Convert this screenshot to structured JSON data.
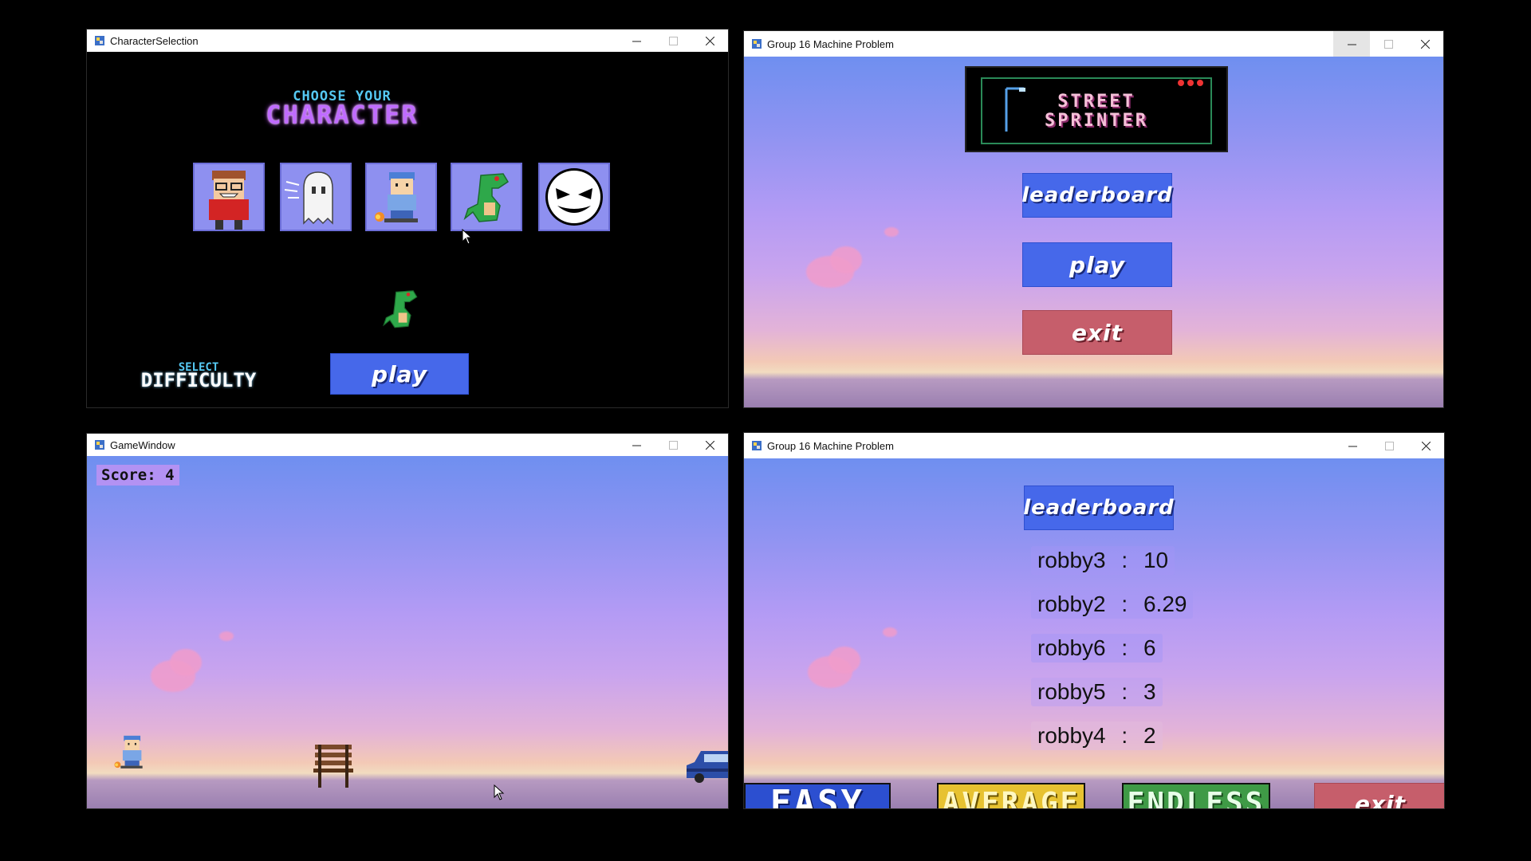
{
  "windows": {
    "char_select": {
      "title": "CharacterSelection"
    },
    "menu": {
      "title": "Group 16 Machine Problem"
    },
    "game": {
      "title": "GameWindow"
    },
    "leaderboard": {
      "title": "Group 16 Machine Problem"
    }
  },
  "char_select": {
    "heading_line1": "CHOOSE YOUR",
    "heading_line2": "CHARACTER",
    "characters": [
      "red-hoodie-boy",
      "ghost",
      "skater-kid",
      "green-dinosaur",
      "moon-face"
    ],
    "selected_character": "green-dinosaur",
    "difficulty_line1": "SELECT",
    "difficulty_line2": "DIFFICULTY",
    "play_label": "play"
  },
  "menu": {
    "logo_line1": "STREET",
    "logo_line2": "SPRINTER",
    "leaderboard_label": "leaderboard",
    "play_label": "play",
    "exit_label": "exit"
  },
  "game": {
    "score_text": "Score: 4"
  },
  "leaderboard": {
    "header_label": "leaderboard",
    "rows": [
      {
        "name": "robby3",
        "sep": ":",
        "score": "10"
      },
      {
        "name": "robby2",
        "sep": ":",
        "score": "6.29"
      },
      {
        "name": "robby6",
        "sep": ":",
        "score": "6"
      },
      {
        "name": "robby5",
        "sep": ":",
        "score": "3"
      },
      {
        "name": "robby4",
        "sep": ":",
        "score": "2"
      }
    ],
    "difficulty_buttons": [
      "EASY",
      "AVERAGE",
      "ENDLESS"
    ],
    "exit_label": "exit"
  },
  "colors": {
    "button_blue": "#4668ea",
    "button_red": "#c65e6b",
    "accent_purple": "#b845f2",
    "accent_cyan": "#55c8f2"
  }
}
